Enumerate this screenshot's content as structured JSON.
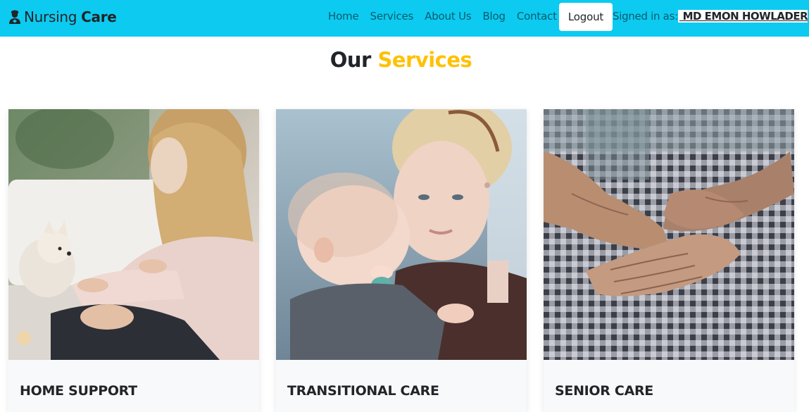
{
  "navbar": {
    "brand_first": "Nursing",
    "brand_second": "Care",
    "brand_icon": "user-nurse-icon",
    "links": [
      "Home",
      "Services",
      "About Us",
      "Blog",
      "Contact"
    ],
    "logout_label": "Logout",
    "signed_in_label": "Signed in as:",
    "user_name": " MD EMON HOWLADER",
    "colors": {
      "background": "#0dcaf0"
    }
  },
  "section": {
    "title_plain": "Our",
    "title_accent": "Services",
    "colors": {
      "accent": "#ffc107"
    }
  },
  "cards": [
    {
      "title": "HOME SUPPORT"
    },
    {
      "title": "TRANSITIONAL CARE"
    },
    {
      "title": "SENIOR CARE"
    }
  ]
}
